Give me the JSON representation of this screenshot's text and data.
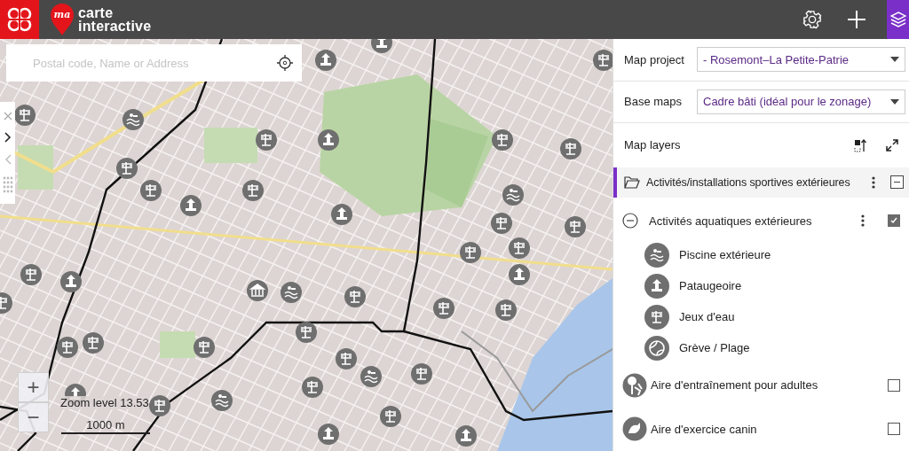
{
  "header": {
    "logo_badge": "ma",
    "title_lines": [
      "carte",
      "interactive"
    ],
    "layers_button": {
      "selected": true
    }
  },
  "search": {
    "placeholder": "Postal code, Name or Address"
  },
  "map": {
    "zoom_in": "+",
    "zoom_out": "−",
    "zoom_level": "Zoom level 13.53",
    "scale": "1000 m"
  },
  "panel": {
    "fields": [
      {
        "label": "Map project",
        "value": "- Rosemont–La Petite-Patrie"
      },
      {
        "label": "Base maps",
        "value": "Cadre bâti (idéal pour le zonage)"
      }
    ],
    "layers_title": "Map layers",
    "layer_groups": [
      {
        "name": "Activités/installations sportives extérieures",
        "selected": true,
        "expanded": true,
        "children": [
          {
            "kind": "category",
            "name": "Activités aquatiques extérieures",
            "expanded": true,
            "checked": true,
            "legend": [
              {
                "name": "Piscine extérieure"
              },
              {
                "name": "Pataugeoire"
              },
              {
                "name": "Jeux d'eau"
              },
              {
                "name": "Grève / Plage"
              }
            ]
          },
          {
            "kind": "layer",
            "name": "Aire d'entraînement pour adultes",
            "checked": false
          },
          {
            "kind": "layer",
            "name": "Aire d'exercice canin",
            "checked": false
          }
        ]
      }
    ]
  }
}
